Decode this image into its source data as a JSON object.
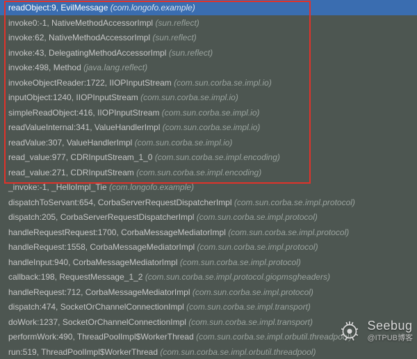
{
  "watermark": {
    "title": "Seebug",
    "subtitle": "@ITPUB博客"
  },
  "stack": [
    {
      "method": "readObject:9, EvilMessage",
      "pkg": "(com.longofo.example)",
      "selected": true
    },
    {
      "method": "invoke0:-1, NativeMethodAccessorImpl",
      "pkg": "(sun.reflect)"
    },
    {
      "method": "invoke:62, NativeMethodAccessorImpl",
      "pkg": "(sun.reflect)"
    },
    {
      "method": "invoke:43, DelegatingMethodAccessorImpl",
      "pkg": "(sun.reflect)"
    },
    {
      "method": "invoke:498, Method",
      "pkg": "(java.lang.reflect)"
    },
    {
      "method": "invokeObjectReader:1722, IIOPInputStream",
      "pkg": "(com.sun.corba.se.impl.io)"
    },
    {
      "method": "inputObject:1240, IIOPInputStream",
      "pkg": "(com.sun.corba.se.impl.io)"
    },
    {
      "method": "simpleReadObject:416, IIOPInputStream",
      "pkg": "(com.sun.corba.se.impl.io)"
    },
    {
      "method": "readValueInternal:341, ValueHandlerImpl",
      "pkg": "(com.sun.corba.se.impl.io)"
    },
    {
      "method": "readValue:307, ValueHandlerImpl",
      "pkg": "(com.sun.corba.se.impl.io)"
    },
    {
      "method": "read_value:977, CDRInputStream_1_0",
      "pkg": "(com.sun.corba.se.impl.encoding)"
    },
    {
      "method": "read_value:271, CDRInputStream",
      "pkg": "(com.sun.corba.se.impl.encoding)"
    },
    {
      "method": "_invoke:-1, _HelloImpl_Tie",
      "pkg": "(com.longofo.example)"
    },
    {
      "method": "dispatchToServant:654, CorbaServerRequestDispatcherImpl",
      "pkg": "(com.sun.corba.se.impl.protocol)"
    },
    {
      "method": "dispatch:205, CorbaServerRequestDispatcherImpl",
      "pkg": "(com.sun.corba.se.impl.protocol)"
    },
    {
      "method": "handleRequestRequest:1700, CorbaMessageMediatorImpl",
      "pkg": "(com.sun.corba.se.impl.protocol)"
    },
    {
      "method": "handleRequest:1558, CorbaMessageMediatorImpl",
      "pkg": "(com.sun.corba.se.impl.protocol)"
    },
    {
      "method": "handleInput:940, CorbaMessageMediatorImpl",
      "pkg": "(com.sun.corba.se.impl.protocol)"
    },
    {
      "method": "callback:198, RequestMessage_1_2",
      "pkg": "(com.sun.corba.se.impl.protocol.giopmsgheaders)"
    },
    {
      "method": "handleRequest:712, CorbaMessageMediatorImpl",
      "pkg": "(com.sun.corba.se.impl.protocol)"
    },
    {
      "method": "dispatch:474, SocketOrChannelConnectionImpl",
      "pkg": "(com.sun.corba.se.impl.transport)"
    },
    {
      "method": "doWork:1237, SocketOrChannelConnectionImpl",
      "pkg": "(com.sun.corba.se.impl.transport)"
    },
    {
      "method": "performWork:490, ThreadPoolImpl$WorkerThread",
      "pkg": "(com.sun.corba.se.impl.orbutil.threadpool)"
    },
    {
      "method": "run:519, ThreadPoolImpl$WorkerThread",
      "pkg": "(com.sun.corba.se.impl.orbutil.threadpool)"
    }
  ]
}
